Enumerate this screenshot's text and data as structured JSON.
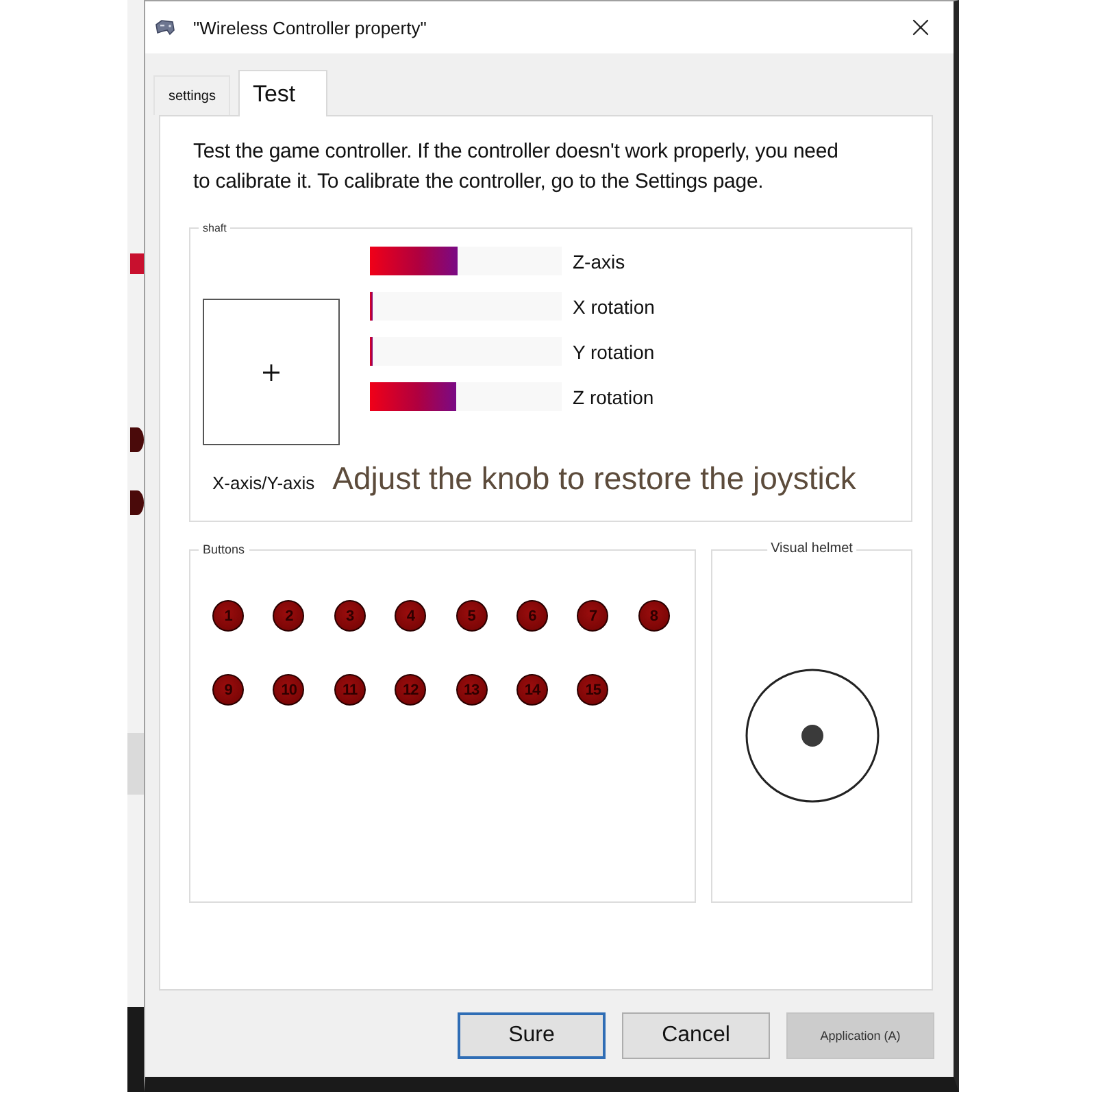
{
  "window": {
    "title": "\"Wireless Controller property\""
  },
  "tabs": [
    {
      "label": "settings",
      "selected": false
    },
    {
      "label": "Test",
      "selected": true
    }
  ],
  "description": "Test the game controller. If the controller doesn't work properly, you need to calibrate it. To calibrate the controller, go to the Settings page.",
  "shaft": {
    "legend": "shaft",
    "axes": [
      {
        "label": "Z-axis",
        "level": 0.46
      },
      {
        "label": "X rotation",
        "level": 0.015
      },
      {
        "label": "Y rotation",
        "level": 0.015
      },
      {
        "label": "Z rotation",
        "level": 0.45
      }
    ],
    "xy_label": "X-axis/Y-axis",
    "note": "Adjust the knob to restore the joystick"
  },
  "buttons_group": {
    "legend": "Buttons",
    "buttons": [
      "1",
      "2",
      "3",
      "4",
      "5",
      "6",
      "7",
      "8",
      "9",
      "10",
      "11",
      "12",
      "13",
      "14",
      "15"
    ]
  },
  "visual_helmet": {
    "legend": "Visual helmet"
  },
  "footer_buttons": [
    {
      "label": "Sure",
      "focused": true,
      "disabled": false
    },
    {
      "label": "Cancel",
      "focused": false,
      "disabled": false
    },
    {
      "label": "Application (A)",
      "focused": false,
      "disabled": true
    }
  ]
}
